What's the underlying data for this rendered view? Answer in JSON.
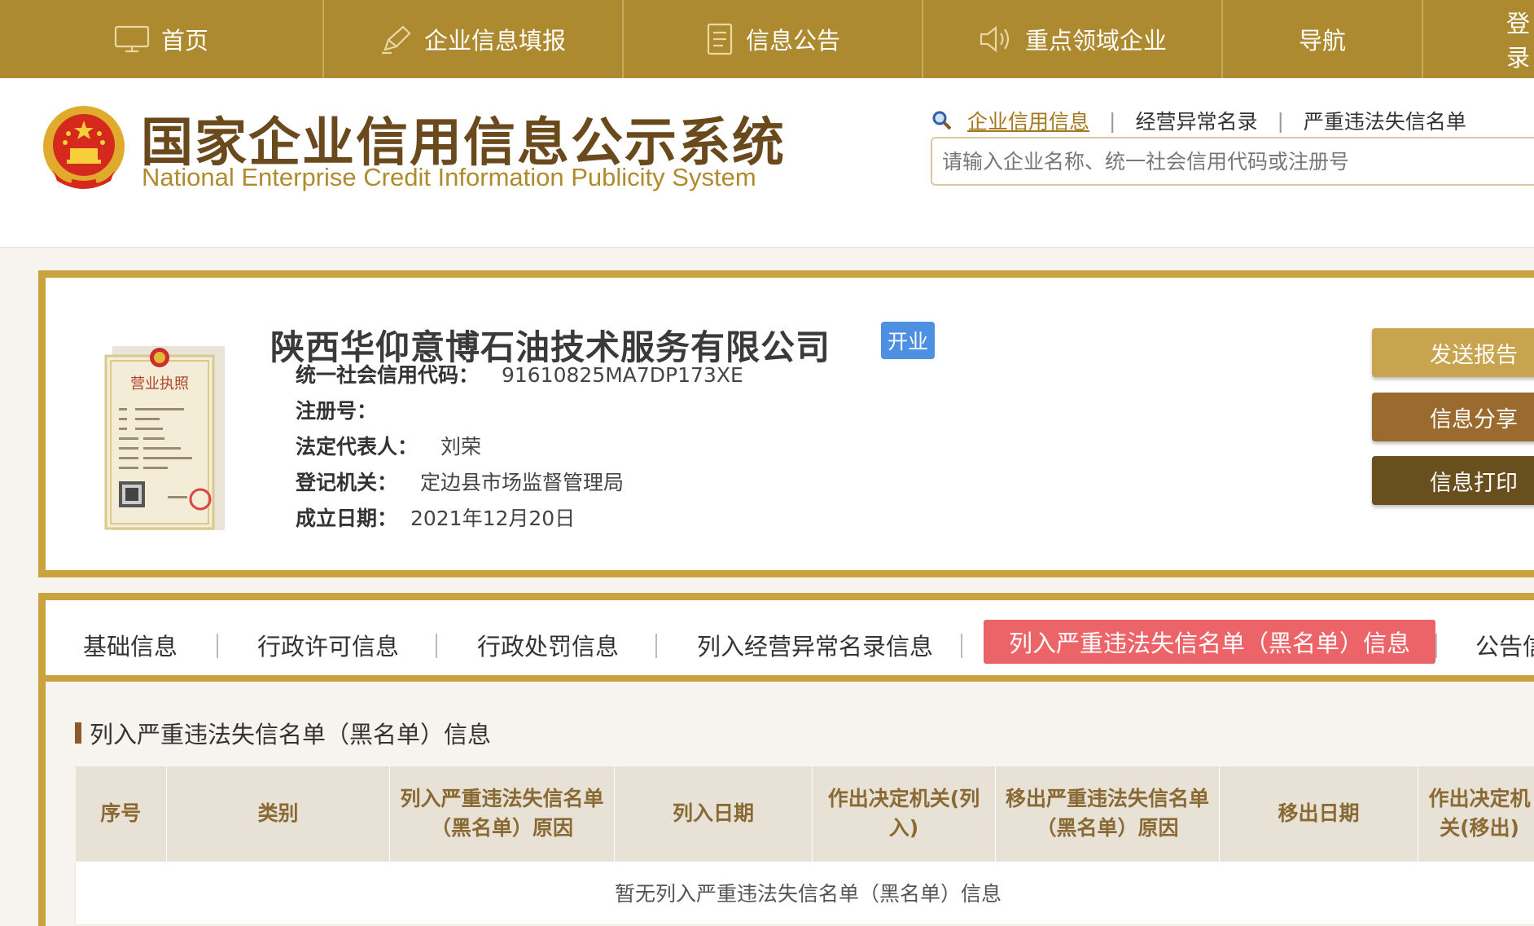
{
  "topnav": {
    "items": [
      {
        "label": "首页",
        "icon": "monitor-icon"
      },
      {
        "label": "企业信息填报",
        "icon": "pen-icon"
      },
      {
        "label": "信息公告",
        "icon": "document-icon"
      },
      {
        "label": "重点领域企业",
        "icon": "speaker-icon"
      },
      {
        "label": "导航",
        "icon": ""
      },
      {
        "label": "登录",
        "icon": ""
      }
    ]
  },
  "header": {
    "title": "国家企业信用信息公示系统",
    "subtitle": "National Enterprise Credit Information Publicity System",
    "search_tabs": [
      "企业信用信息",
      "经营异常名录",
      "严重违法失信名单"
    ],
    "search_placeholder": "请输入企业名称、统一社会信用代码或注册号"
  },
  "company": {
    "name": "陕西华仰意博石油技术服务有限公司",
    "status": "开业",
    "fields": [
      {
        "key": "统一社会信用代码：",
        "value": "91610825MA7DP173XE"
      },
      {
        "key": "注册号：",
        "value": ""
      },
      {
        "key": "法定代表人：",
        "value": "刘荣"
      },
      {
        "key": "登记机关：",
        "value": "定边县市场监督管理局"
      },
      {
        "key": "成立日期：",
        "value": "2021年12月20日"
      }
    ],
    "license_text": "营业执照",
    "actions": [
      {
        "label": "发送报告",
        "color": "#c9a44e"
      },
      {
        "label": "信息分享",
        "color": "#9a6a2e"
      },
      {
        "label": "信息打印",
        "color": "#6a4f1e"
      }
    ]
  },
  "tabs": {
    "items": [
      "基础信息",
      "行政许可信息",
      "行政处罚信息",
      "列入经营异常名录信息",
      "列入严重违法失信名单（黑名单）信息",
      "公告信息"
    ],
    "active_index": 4
  },
  "section": {
    "title": "列入严重违法失信名单（黑名单）信息",
    "columns": [
      "序号",
      "类别",
      "列入严重违法失信名单（黑名单）原因",
      "列入日期",
      "作出决定机关(列入)",
      "移出严重违法失信名单（黑名单）原因",
      "移出日期",
      "作出决定机关(移出)"
    ],
    "empty_message": "暂无列入严重违法失信名单（黑名单）信息"
  },
  "colors": {
    "nav_bg": "#ad8a2f",
    "frame": "#c9a33e",
    "active_tab": "#ec6368",
    "status_badge": "#4d8fe0"
  }
}
